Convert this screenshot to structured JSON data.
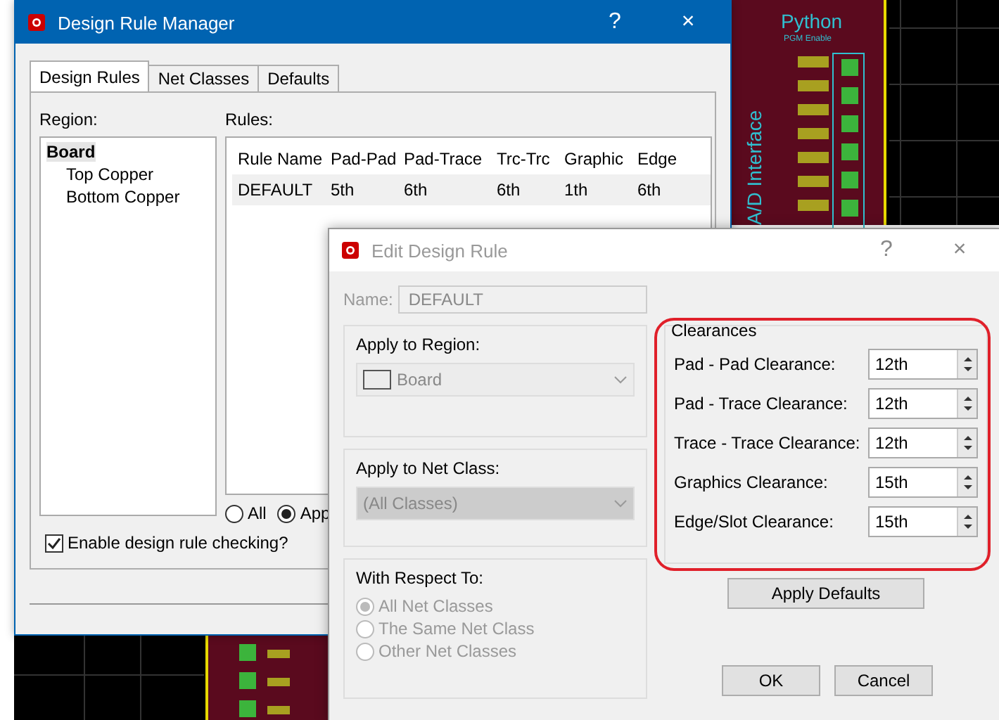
{
  "canvas_labels": [
    "Python",
    "PGM Enable",
    "A/D Interface"
  ],
  "main_window": {
    "title": "Design Rule Manager",
    "title_buttons": [
      "?",
      "×"
    ],
    "tabs": [
      {
        "label": "Design Rules",
        "selected": true
      },
      {
        "label": "Net Classes",
        "selected": false
      },
      {
        "label": "Defaults",
        "selected": false
      }
    ],
    "region": {
      "label": "Region:",
      "tree": [
        {
          "label": "Board",
          "selected": true,
          "children": [
            {
              "label": "Top Copper",
              "selected": false
            },
            {
              "label": "Bottom Copper",
              "selected": false
            }
          ]
        }
      ]
    },
    "rules": {
      "label": "Rules:",
      "columns": [
        "Rule Name",
        "Pad-Pad",
        "Pad-Trace",
        "Trc-Trc",
        "Graphic",
        "Edge"
      ],
      "rows": [
        {
          "cells": [
            "DEFAULT",
            "5th",
            "6th",
            "6th",
            "1th",
            "6th"
          ],
          "selected": true
        }
      ]
    },
    "scope_radios": [
      {
        "label": "All",
        "selected": false
      },
      {
        "label": "App",
        "selected": true
      }
    ],
    "enable_checking": {
      "label": "Enable design rule checking?",
      "checked": true
    }
  },
  "edit_dialog": {
    "title": "Edit Design Rule",
    "title_buttons": [
      "?",
      "×"
    ],
    "name_label": "Name:",
    "name_value": "DEFAULT",
    "region_group": {
      "title": "Apply to Region:",
      "value": "Board"
    },
    "net_class_group": {
      "title": "Apply to Net Class:",
      "value": "(All Classes)"
    },
    "respect_group": {
      "title": "With Respect To:",
      "options": [
        {
          "label": "All Net Classes",
          "selected": true
        },
        {
          "label": "The Same Net Class",
          "selected": false
        },
        {
          "label": "Other Net Classes",
          "selected": false
        }
      ]
    },
    "clearances": {
      "title": "Clearances",
      "fields": [
        {
          "label": "Pad - Pad Clearance:",
          "value": "12th"
        },
        {
          "label": "Pad - Trace Clearance:",
          "value": "12th"
        },
        {
          "label": "Trace - Trace Clearance:",
          "value": "12th"
        },
        {
          "label": "Graphics Clearance:",
          "value": "15th"
        },
        {
          "label": "Edge/Slot Clearance:",
          "value": "15th"
        }
      ]
    },
    "apply_defaults": "Apply Defaults",
    "buttons": [
      "OK",
      "Cancel"
    ]
  }
}
